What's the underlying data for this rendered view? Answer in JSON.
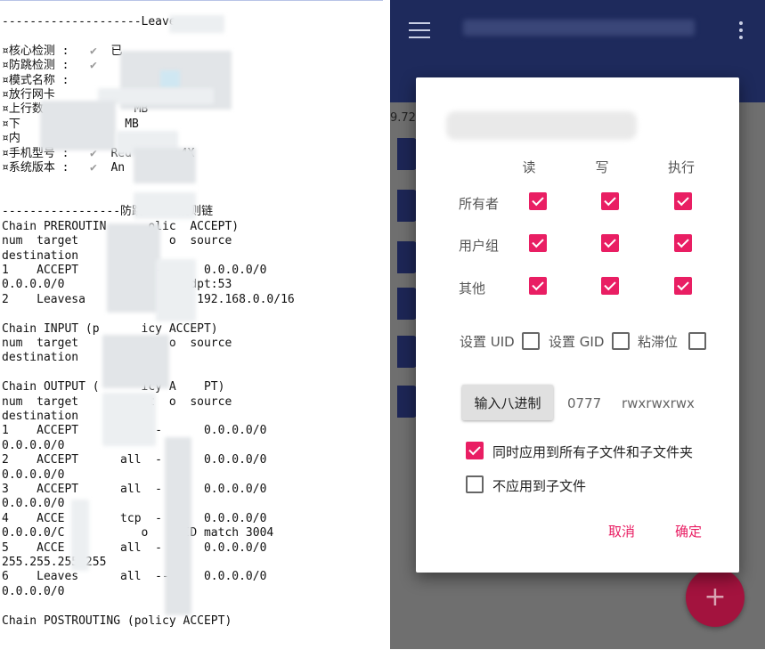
{
  "log": {
    "lines": [
      "--------------------Leave",
      "",
      "¤核心检测 :   ✔  已",
      "¤防跳检测 :   ✔",
      "¤模式名称 :",
      "¤放行网卡                   ano",
      "¤上行数             MB",
      "¤下           ✔   MB",
      "¤内        ✔",
      "¤手机型号 :   ✔  Red       4X",
      "¤系统版本 :   ✔  An       )",
      "",
      "",
      "-----------------防跳     规则链",
      "Chain PREROUTIN      olic  ACCEPT)",
      "num  target        rot  o  source",
      "destination",
      "1    ACCEPT       dp  -      0.0.0.0/0",
      "0.0.0.0/0               u  dpt:53",
      "2    Leavesa       ll  -    192.168.0.0/16",
      "",
      "Chain INPUT (p      icy ACCEPT)",
      "num  target        rot  o  source",
      "destination",
      "",
      "Chain OUTPUT (      icy A    PT)",
      "num  target        rot  o  source",
      "destination",
      "1    ACCEPT      all  -      0.0.0.0/0",
      "0.0.0.0/0",
      "2    ACCEPT      all  -      0.0.0.0/0",
      "0.0.0.0/0",
      "3    ACCEPT      all  -      0.0.0.0/0",
      "0.0.0.0/0",
      "4    ACCE        tcp  -      0.0.0.0/0",
      "0.0.0.0/C           o    UID match 3004",
      "5    ACCE        all  -      0.0.0.0/0",
      "255.255.255.255",
      "6    Leaves      all  --     0.0.0.0/0",
      "0.0.0.0/0",
      "",
      "Chain POSTROUTING (policy ACCEPT)"
    ]
  },
  "app": {
    "partial_text": "9.72",
    "fab_label": "+"
  },
  "dialog": {
    "columns": [
      "读",
      "写",
      "执行"
    ],
    "rows": [
      {
        "label": "所有者",
        "values": [
          true,
          true,
          true
        ]
      },
      {
        "label": "用户组",
        "values": [
          true,
          true,
          true
        ]
      },
      {
        "label": "其他",
        "values": [
          true,
          true,
          true
        ]
      }
    ],
    "flags": [
      {
        "label": "设置 UID",
        "checked": false
      },
      {
        "label": "设置 GID",
        "checked": false
      },
      {
        "label": "粘滞位",
        "checked": false
      }
    ],
    "octal_button_label": "输入八进制",
    "octal_value": "0777",
    "permission_string": "rwxrwxrwx",
    "options": [
      {
        "label": "同时应用到所有子文件和子文件夹",
        "checked": true
      },
      {
        "label": "不应用到子文件",
        "checked": false
      }
    ],
    "cancel_label": "取消",
    "ok_label": "确定"
  },
  "colors": {
    "accent": "#e91e63",
    "app_bar": "#1e2a5c",
    "fab": "#a3133e"
  }
}
